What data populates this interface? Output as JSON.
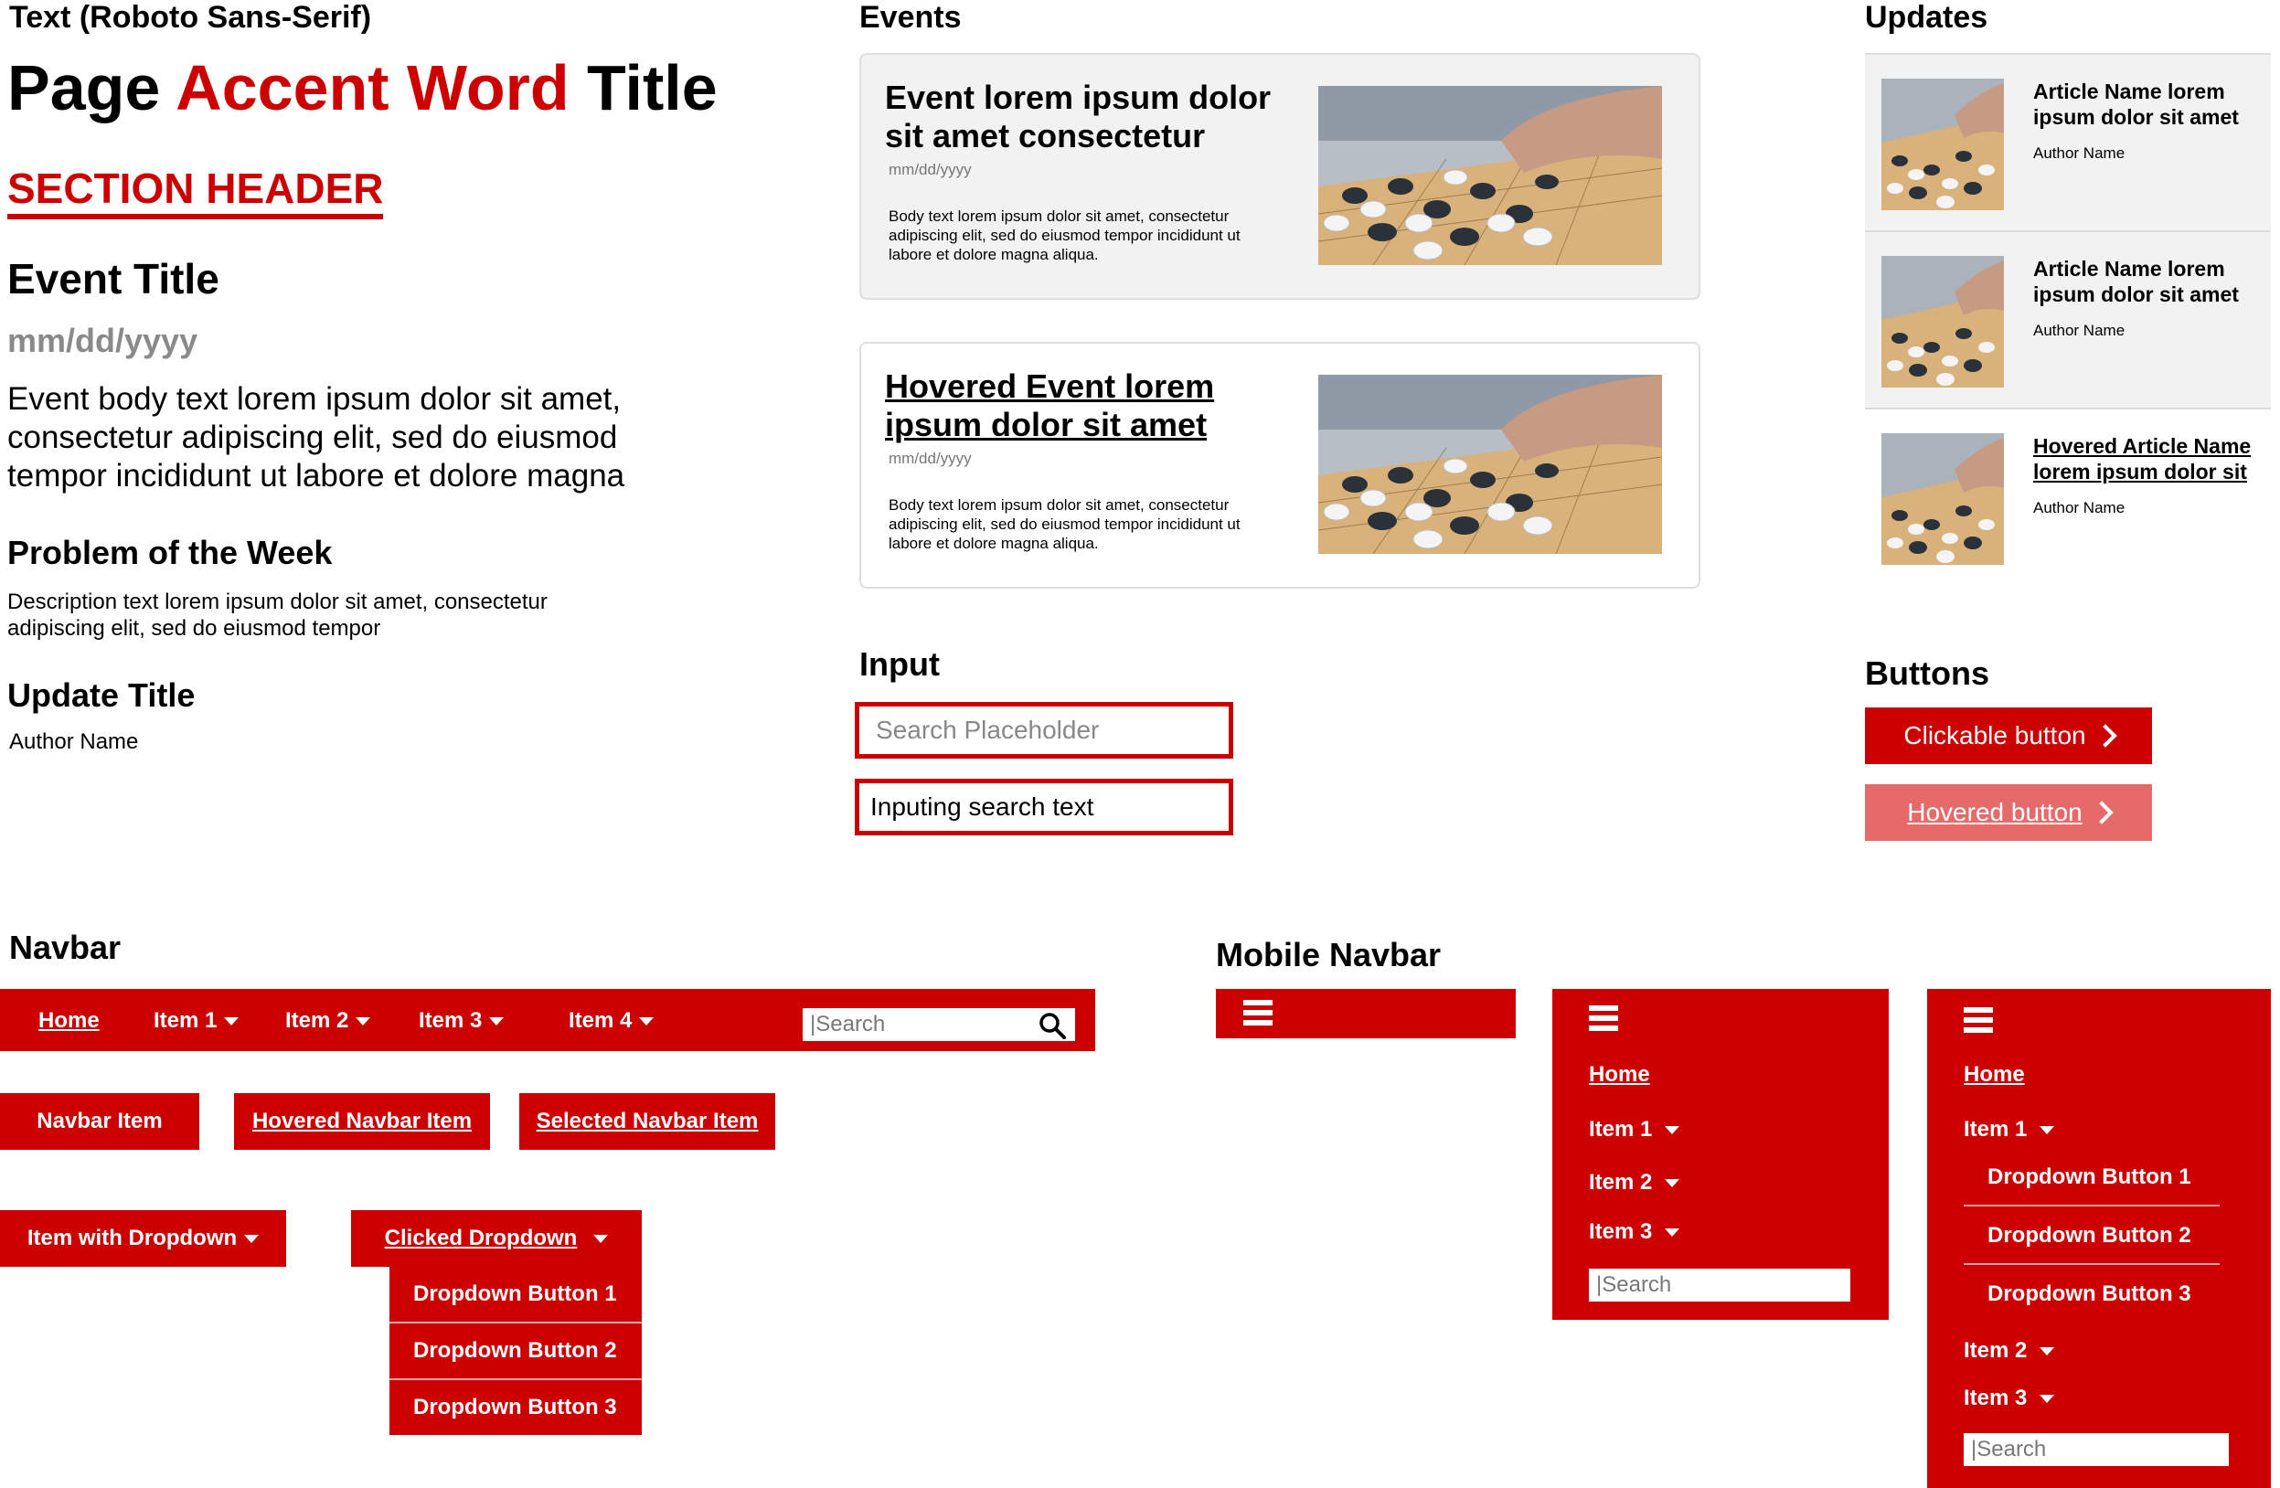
{
  "text": {
    "caption": "Text (Roboto Sans-Serif)",
    "page_title_before": "Page ",
    "page_title_accent": "Accent Word",
    "page_title_after": " Title",
    "section_header": "SECTION HEADER",
    "event_title": "Event Title",
    "event_date": "mm/dd/yyyy",
    "event_body": "Event body text lorem ipsum dolor sit amet, consectetur adipiscing elit, sed do eiusmod tempor incididunt ut labore et dolore magna",
    "problem_title": "Problem of the Week",
    "problem_desc": "Description text lorem ipsum dolor sit amet, consectetur adipiscing elit, sed do eiusmod tempor",
    "update_title": "Update Title",
    "author": "Author Name"
  },
  "events": {
    "heading": "Events",
    "cards": [
      {
        "title": "Event lorem ipsum dolor sit amet consectetur",
        "date": "mm/dd/yyyy",
        "body": "Body text lorem ipsum dolor sit amet, consectetur adipiscing elit, sed do eiusmod tempor incididunt ut labore et dolore magna aliqua."
      },
      {
        "title": "Hovered Event lorem ipsum dolor sit amet",
        "date": "mm/dd/yyyy",
        "body": "Body text lorem ipsum dolor sit amet, consectetur adipiscing elit, sed do eiusmod tempor incididunt ut labore et dolore magna aliqua."
      }
    ]
  },
  "updates": {
    "heading": "Updates",
    "items": [
      {
        "title": "Article Name lorem ipsum dolor sit amet",
        "author": "Author Name"
      },
      {
        "title": "Article Name lorem ipsum dolor sit amet",
        "author": "Author Name"
      },
      {
        "title": "Hovered Article Name lorem ipsum dolor sit",
        "author": "Author Name"
      }
    ]
  },
  "input": {
    "heading": "Input",
    "placeholder": "Search Placeholder",
    "typed": "Inputing search text"
  },
  "buttons": {
    "heading": "Buttons",
    "clickable": "Clickable button",
    "hovered": "Hovered button"
  },
  "navbar": {
    "heading": "Navbar",
    "items": [
      "Home",
      "Item 1",
      "Item 2",
      "Item 3",
      "Item 4"
    ],
    "search_placeholder": "|Search",
    "navbar_item": "Navbar Item",
    "hovered_item": "Hovered Navbar Item",
    "selected_item": "Selected Navbar Item",
    "item_dropdown": "Item with Dropdown",
    "clicked_dropdown": "Clicked Dropdown",
    "dropdown_buttons": [
      "Dropdown Button 1",
      "Dropdown Button 2",
      "Dropdown Button 3"
    ]
  },
  "mobile": {
    "heading": "Mobile Navbar",
    "items": [
      "Home",
      "Item 1",
      "Item 2",
      "Item 3"
    ],
    "search_placeholder": "|Search",
    "dropdown_buttons": [
      "Dropdown Button 1",
      "Dropdown Button 2",
      "Dropdown Button 3"
    ]
  },
  "colors": {
    "accent": "#cc0000",
    "hover": "#e56b6b",
    "card_bg": "#f2f2f2"
  }
}
